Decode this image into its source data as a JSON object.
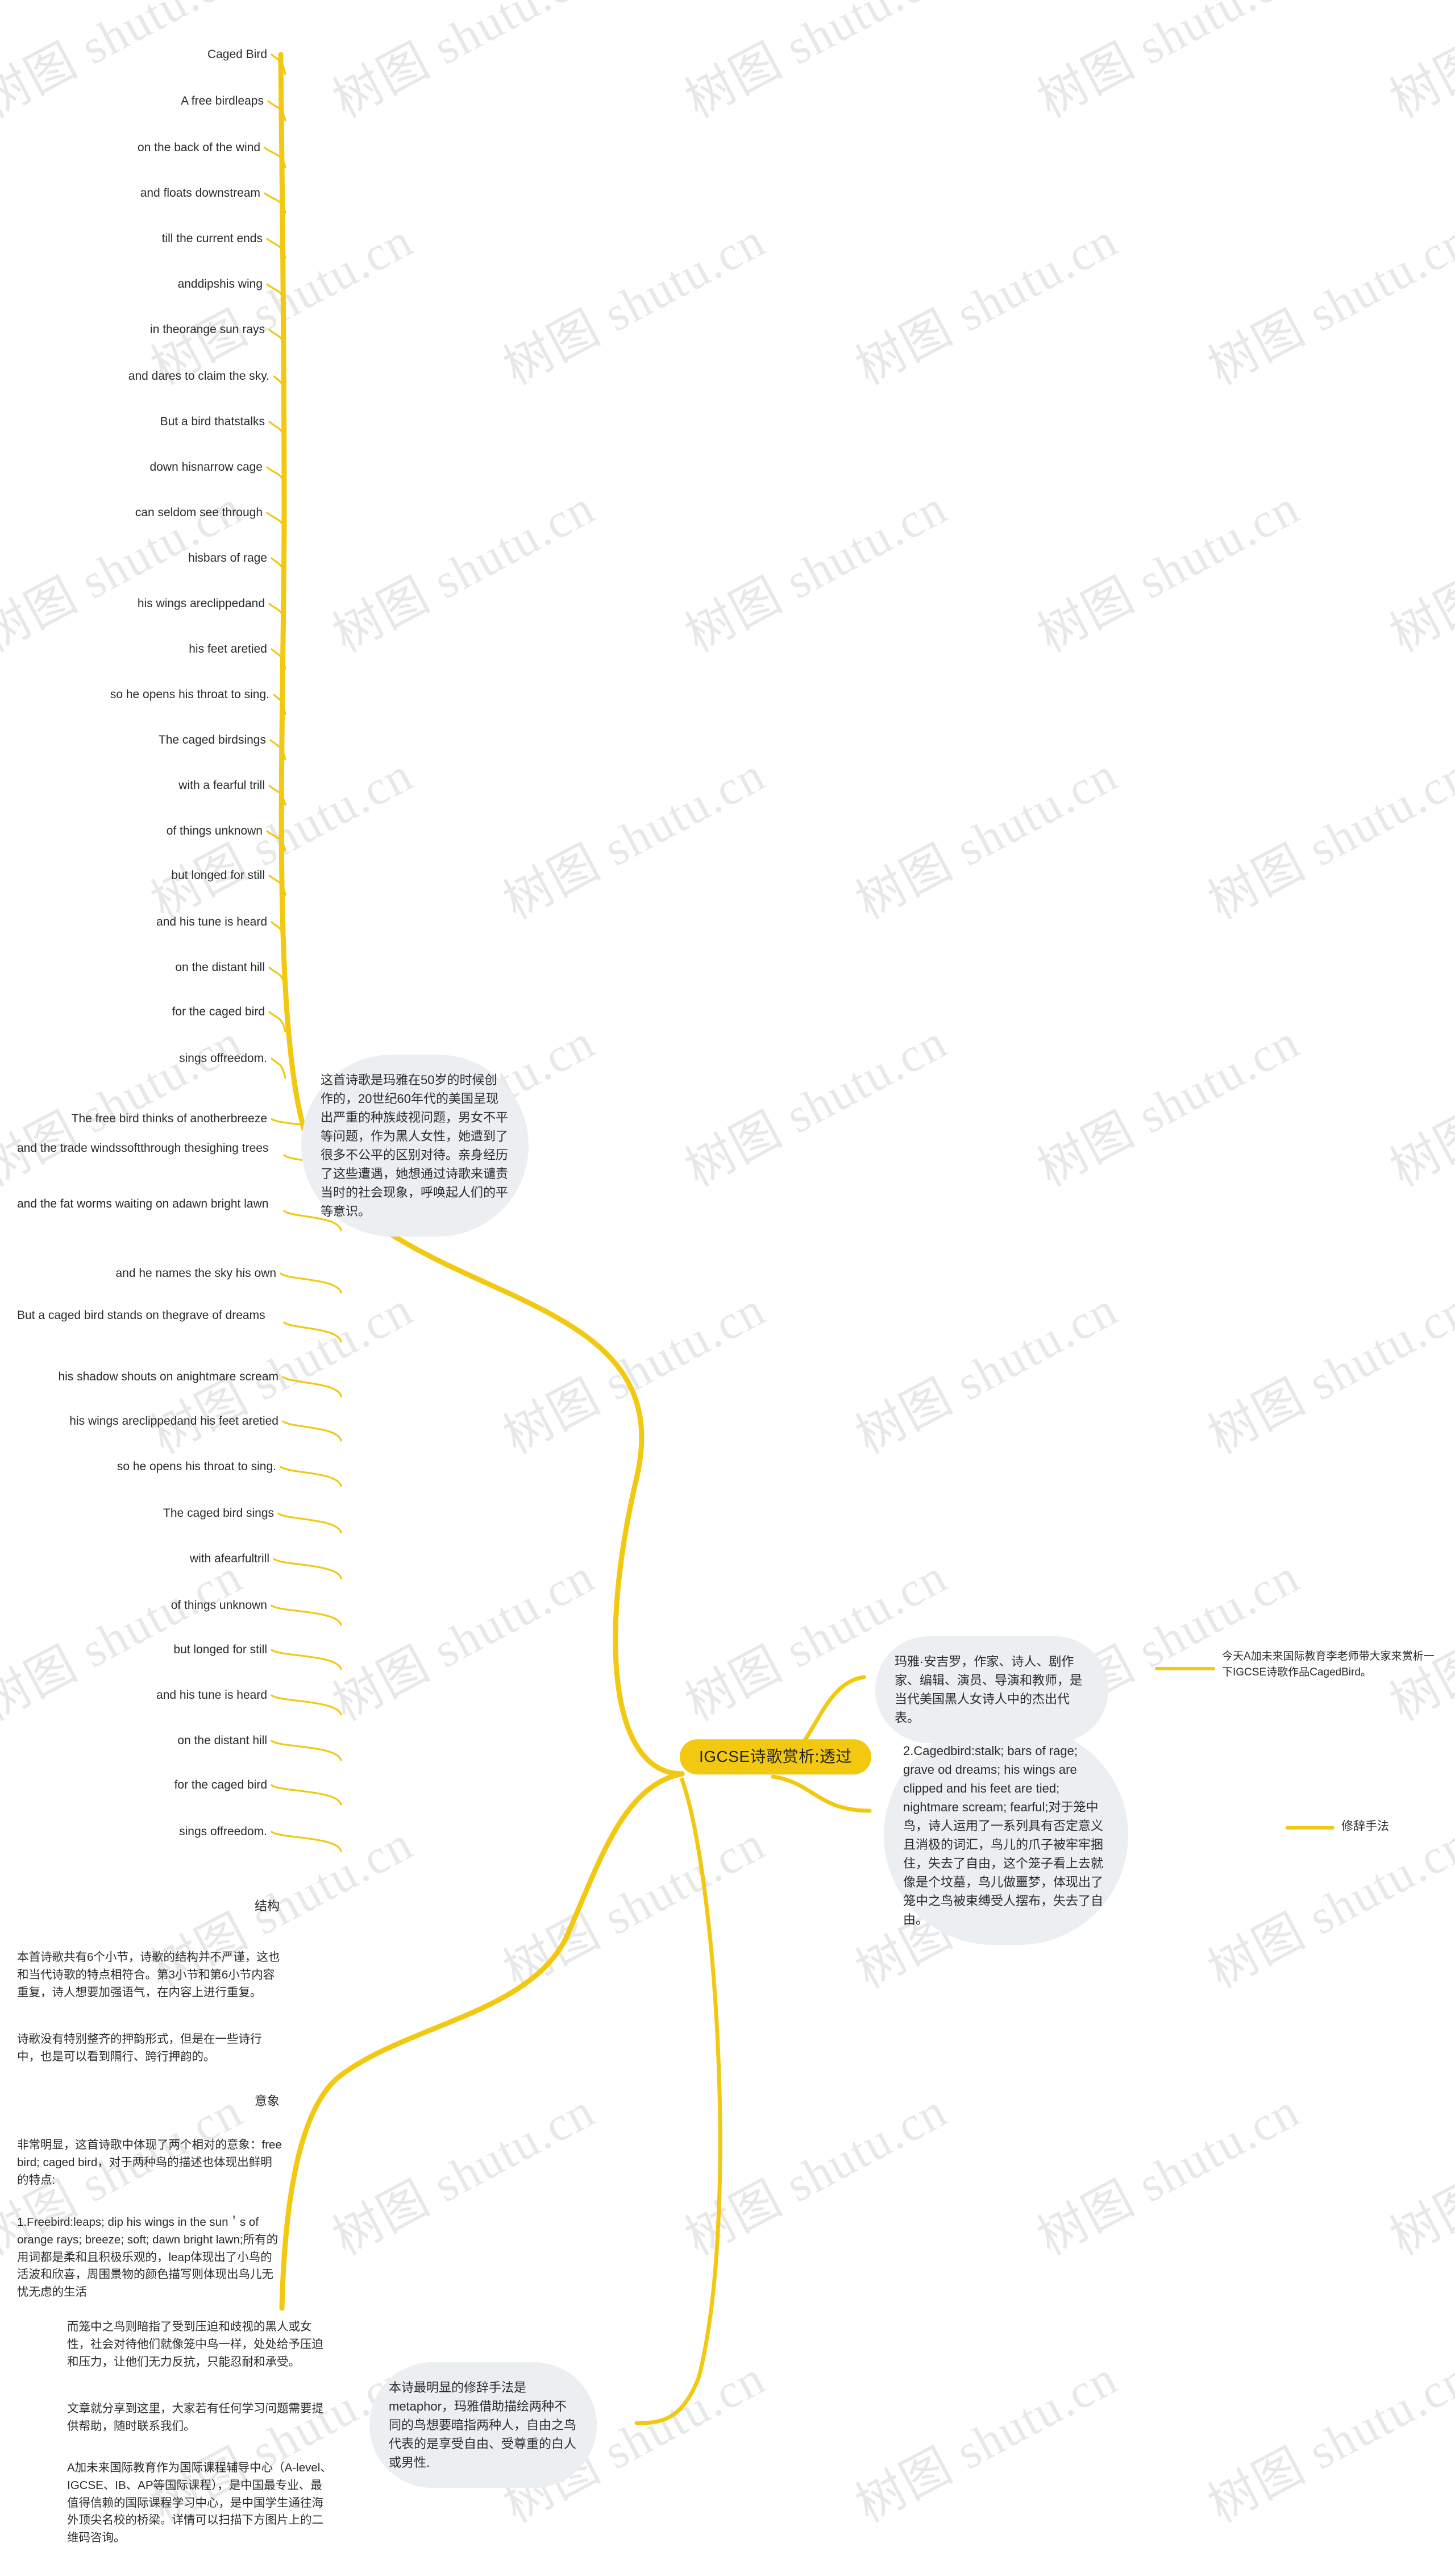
{
  "colors": {
    "branch": "#F2C811",
    "root_fill": "#F2C811",
    "bubble_fill": "#eceff1",
    "text": "#2b2b2b",
    "background": "#ffffff"
  },
  "watermark": {
    "text": "树图 shutu.cn"
  },
  "root": {
    "label": "IGCSE诗歌赏析:透过"
  },
  "poem_lines": [
    {
      "text": "Caged Bird"
    },
    {
      "text": "A free birdleaps"
    },
    {
      "text": "on the back of the wind"
    },
    {
      "text": "and floats downstream"
    },
    {
      "text": "till the current ends"
    },
    {
      "text": "anddipshis wing"
    },
    {
      "text": "in theorange sun rays"
    },
    {
      "text": "and dares to claim the sky."
    },
    {
      "text": "But a bird thatstalks"
    },
    {
      "text": "down hisnarrow cage"
    },
    {
      "text": "can seldom see through"
    },
    {
      "text": "hisbars of rage"
    },
    {
      "text": "his wings areclippedand"
    },
    {
      "text": "his feet aretied"
    },
    {
      "text": "so he opens his throat to sing."
    },
    {
      "text": "The caged birdsings"
    },
    {
      "text": "with a fearful trill"
    },
    {
      "text": "of things unknown"
    },
    {
      "text": "but longed for still"
    },
    {
      "text": "and his tune is heard"
    },
    {
      "text": "on the distant hill"
    },
    {
      "text": "for the caged bird"
    },
    {
      "text": "sings offreedom."
    },
    {
      "text": "The free bird thinks of anotherbreeze"
    },
    {
      "text": "and the trade windssoftthrough thesighing trees"
    },
    {
      "text": "and the fat worms waiting on adawn bright lawn"
    },
    {
      "text": "and he names the sky his own"
    },
    {
      "text": "But a caged bird stands on thegrave of dreams"
    },
    {
      "text": "his shadow shouts on anightmare scream"
    },
    {
      "text": "his wings areclippedand his feet aretied"
    },
    {
      "text": "so he opens his throat to sing."
    },
    {
      "text": "The caged bird sings"
    },
    {
      "text": "with afearfultrill"
    },
    {
      "text": "of things unknown"
    },
    {
      "text": "but longed for still"
    },
    {
      "text": "and his tune is heard"
    },
    {
      "text": "on the distant hill"
    },
    {
      "text": "for the caged bird"
    },
    {
      "text": "sings offreedom."
    }
  ],
  "sections": {
    "structure_label": "结构",
    "structure_body": "本首诗歌共有6个小节，诗歌的结构并不严谨，这也和当代诗歌的特点相符合。第3小节和第6小节内容重复，诗人想要加强语气，在内容上进行重复。",
    "rhyme_body": "诗歌没有特别整齐的押韵形式，但是在一些诗行中，也是可以看到隔行、跨行押韵的。",
    "imagery_label": "意象",
    "imagery_intro": "非常明显，这首诗歌中体现了两个相对的意象：free bird; caged bird，对于两种鸟的描述也体现出鲜明的特点:",
    "free_bird_body": "1.Freebird:leaps; dip his wings in the sun＇s of orange rays; breeze; soft; dawn bright lawn;所有的用词都是柔和且积极乐观的，leap体现出了小鸟的活波和欣喜，周围景物的颜色描写则体现出鸟儿无忧无虑的生活",
    "caged_meaning_body": "而笼中之鸟则暗指了受到压迫和歧视的黑人或女性，社会对待他们就像笼中鸟一样，处处给予压迫和压力，让他们无力反抗，只能忍耐和承受。",
    "closing_body": "文章就分享到这里，大家若有任何学习问题需要提供帮助，随时联系我们。",
    "org_body": "A加未来国际教育作为国际课程辅导中心（A-level、IGCSE、IB、AP等国际课程），是中国最专业、最值得信赖的国际课程学习中心，是中国学生通往海外顶尖名校的桥梁。详情可以扫描下方图片上的二维码咨询。"
  },
  "bubbles": {
    "background_note": "这首诗歌是玛雅在50岁的时候创作的，20世纪60年代的美国呈现出严重的种族歧视问题，男女不平等问题，作为黑人女性，她遭到了很多不公平的区别对待。亲身经历了这些遭遇，她想通过诗歌来谴责当时的社会现象，呼唤起人们的平等意识。",
    "author_note": "玛雅·安吉罗，作家、诗人、剧作家、编辑、演员、导演和教师，是当代美国黑人女诗人中的杰出代表。",
    "caged_bird_note": "2.Cagedbird:stalk; bars of rage; grave od dreams; his wings are clipped and his feet are tied; nightmare scream; fearful;对于笼中鸟，诗人运用了一系列具有否定意义且消极的词汇，鸟儿的爪子被牢牢捆住，失去了自由，这个笼子看上去就像是个坟墓，鸟儿做噩梦，体现出了笼中之鸟被束缚受人摆布，失去了自由。",
    "metaphor_note": "本诗最明显的修辞手法是metaphor，玛雅借助描绘两种不同的鸟想要暗指两种人，自由之鸟代表的是享受自由、受尊重的白人或男性."
  },
  "right_nodes": {
    "intro_note": "今天A加未来国际教育李老师带大家来赏析一下IGCSE诗歌作品CagedBird。",
    "rhetoric_label": "修辞手法"
  }
}
